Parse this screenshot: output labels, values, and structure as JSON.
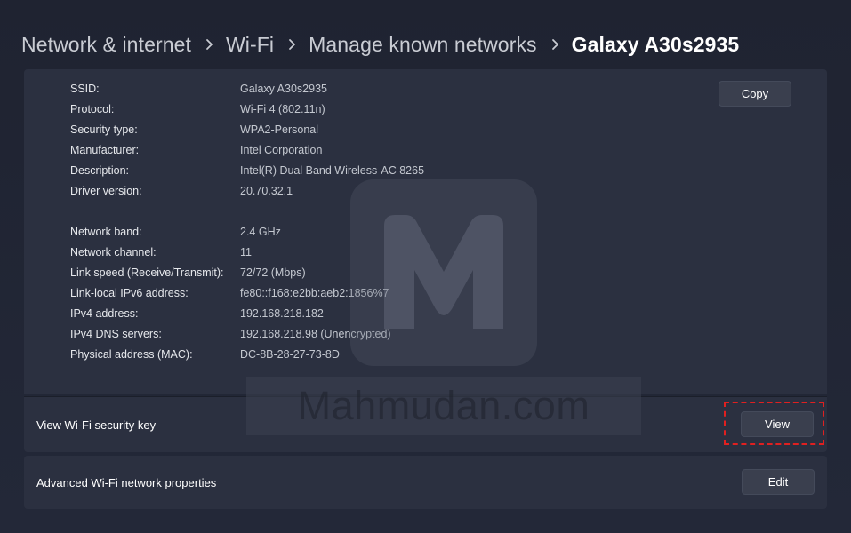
{
  "breadcrumb": {
    "items": [
      "Network & internet",
      "Wi-Fi",
      "Manage known networks"
    ],
    "current": "Galaxy A30s2935"
  },
  "details": {
    "copy_label": "Copy",
    "group1": [
      {
        "key": "SSID:",
        "value": "Galaxy A30s2935"
      },
      {
        "key": "Protocol:",
        "value": "Wi-Fi 4 (802.11n)"
      },
      {
        "key": "Security type:",
        "value": "WPA2-Personal"
      },
      {
        "key": "Manufacturer:",
        "value": "Intel Corporation"
      },
      {
        "key": "Description:",
        "value": "Intel(R) Dual Band Wireless-AC 8265"
      },
      {
        "key": "Driver version:",
        "value": "20.70.32.1"
      }
    ],
    "group2": [
      {
        "key": "Network band:",
        "value": "2.4 GHz"
      },
      {
        "key": "Network channel:",
        "value": "11"
      },
      {
        "key": "Link speed (Receive/Transmit):",
        "value": "72/72 (Mbps)"
      },
      {
        "key": "Link-local IPv6 address:",
        "value": "fe80::f168:e2bb:aeb2:1856%7"
      },
      {
        "key": "IPv4 address:",
        "value": "192.168.218.182"
      },
      {
        "key": "IPv4 DNS servers:",
        "value": "192.168.218.98 (Unencrypted)"
      },
      {
        "key": "Physical address (MAC):",
        "value": "DC-8B-28-27-73-8D"
      }
    ]
  },
  "security_key": {
    "label": "View Wi-Fi security key",
    "button_label": "View"
  },
  "advanced": {
    "label": "Advanced Wi-Fi network properties",
    "button_label": "Edit"
  },
  "watermark": {
    "text": "Mahmudan.com"
  },
  "colors": {
    "background": "#202533",
    "card": "#2b3040",
    "button": "#3a3f4e",
    "highlight": "#e02020"
  },
  "icons": {
    "breadcrumb_separator": "chevron-right-icon",
    "watermark_logo": "m-logo-icon"
  }
}
